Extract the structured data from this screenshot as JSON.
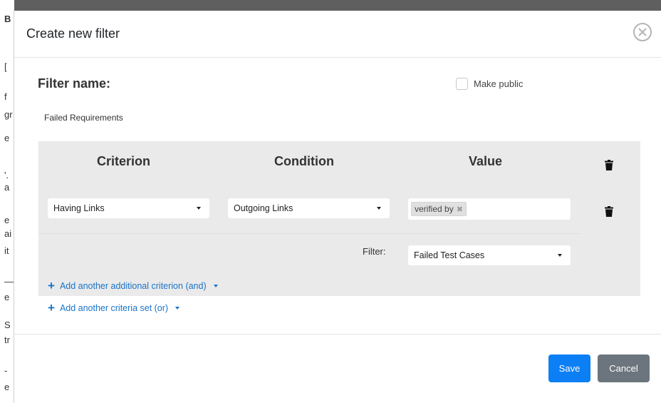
{
  "background": {
    "letters": [
      "B",
      "[",
      "f",
      "gr",
      "e",
      "'.",
      "a",
      "e",
      "ai",
      "it",
      "—",
      "e",
      "S",
      "tr",
      "-",
      "e"
    ]
  },
  "modal": {
    "title": "Create new filter",
    "close_icon": "close-circle-icon"
  },
  "form": {
    "filter_name_label": "Filter name:",
    "filter_name_value": "Failed Requirements",
    "make_public_label": "Make public",
    "make_public_checked": false
  },
  "criteria": {
    "headers": {
      "criterion": "Criterion",
      "condition": "Condition",
      "value": "Value"
    },
    "row": {
      "criterion": "Having Links",
      "condition": "Outgoing Links",
      "value_tag": "verified by"
    },
    "sub_filter": {
      "label": "Filter:",
      "value": "Failed Test Cases"
    },
    "add_and_label": "Add another additional criterion (and)",
    "add_or_label": "Add another criteria set (or)"
  },
  "footer": {
    "save_label": "Save",
    "cancel_label": "Cancel"
  },
  "colors": {
    "primary": "#0d7ff5",
    "secondary": "#6c757d",
    "link": "#1a73c9",
    "criteria_bg": "#eaeaea"
  }
}
